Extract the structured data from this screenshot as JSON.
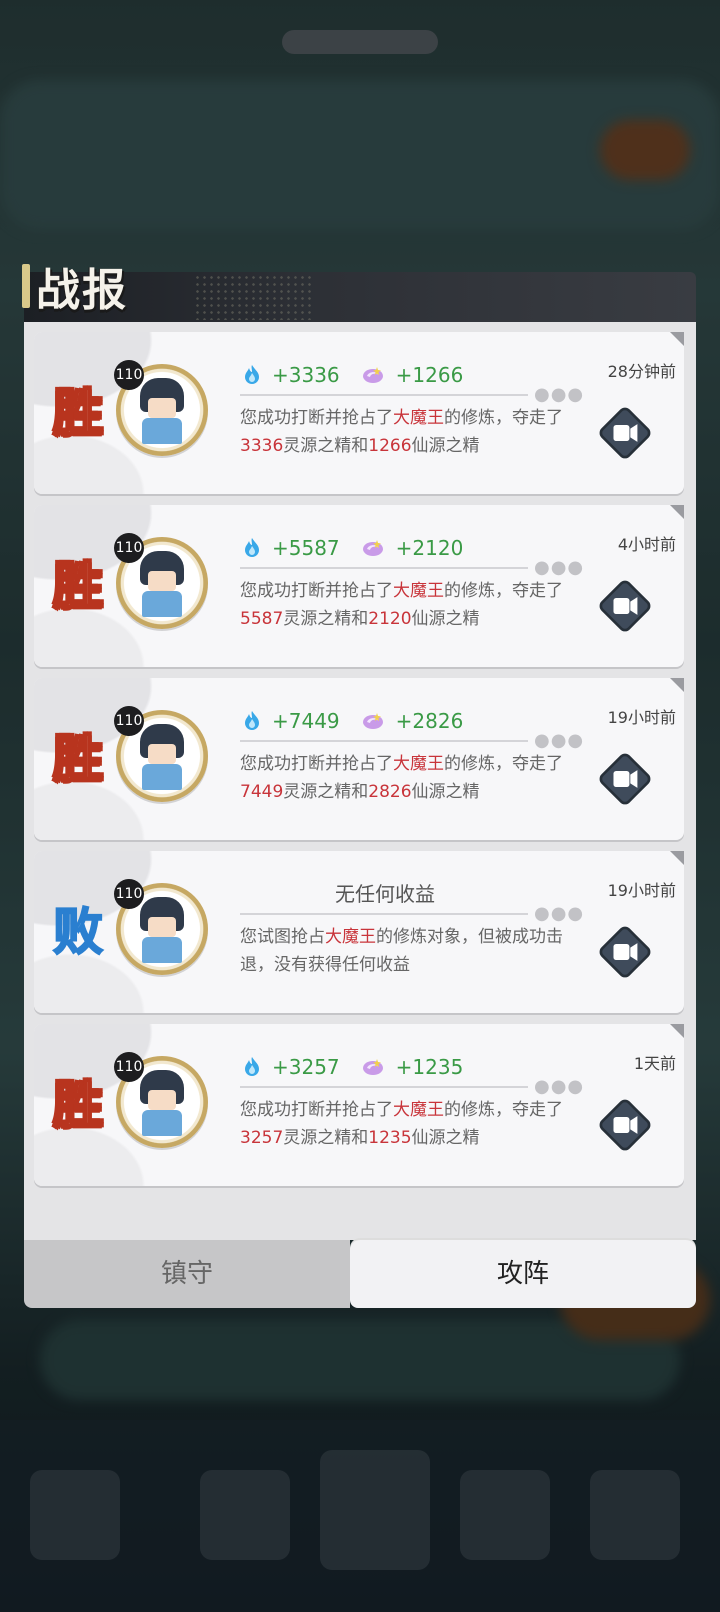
{
  "panel": {
    "title": "战报"
  },
  "icons": {
    "spirit": "blue-flame-icon",
    "immortal": "purple-swirl-icon",
    "video": "video-replay-icon"
  },
  "colors": {
    "win": "#b8341e",
    "lose": "#2a7fd0",
    "gain": "#3a9a46",
    "highlight": "#c8343a"
  },
  "reports": [
    {
      "result": "胜",
      "level": "110",
      "spirit": "+3336",
      "immortal": "+1266",
      "time": "28分钟前",
      "desc": {
        "p1": "您成功打断并抢占了",
        "boss": "大魔王",
        "p2": "的修炼，夺走了",
        "v1": "3336",
        "p3": "灵源之精和",
        "v2": "1266",
        "p4": "仙源之精"
      }
    },
    {
      "result": "胜",
      "level": "110",
      "spirit": "+5587",
      "immortal": "+2120",
      "time": "4小时前",
      "desc": {
        "p1": "您成功打断并抢占了",
        "boss": "大魔王",
        "p2": "的修炼，夺走了",
        "v1": "5587",
        "p3": "灵源之精和",
        "v2": "2120",
        "p4": "仙源之精"
      }
    },
    {
      "result": "胜",
      "level": "110",
      "spirit": "+7449",
      "immortal": "+2826",
      "time": "19小时前",
      "desc": {
        "p1": "您成功打断并抢占了",
        "boss": "大魔王",
        "p2": "的修炼，夺走了",
        "v1": "7449",
        "p3": "灵源之精和",
        "v2": "2826",
        "p4": "仙源之精"
      }
    },
    {
      "result": "败",
      "level": "110",
      "no_gain": "无任何收益",
      "time": "19小时前",
      "desc": {
        "p1": "您试图抢占",
        "boss": "大魔王",
        "p2": "的修炼对象，但被成功击退，没有获得任何收益"
      }
    },
    {
      "result": "胜",
      "level": "110",
      "spirit": "+3257",
      "immortal": "+1235",
      "time": "1天前",
      "desc": {
        "p1": "您成功打断并抢占了",
        "boss": "大魔王",
        "p2": "的修炼，夺走了",
        "v1": "3257",
        "p3": "灵源之精和",
        "v2": "1235",
        "p4": "仙源之精"
      }
    }
  ],
  "tabs": {
    "defend": "镇守",
    "attack": "攻阵"
  }
}
